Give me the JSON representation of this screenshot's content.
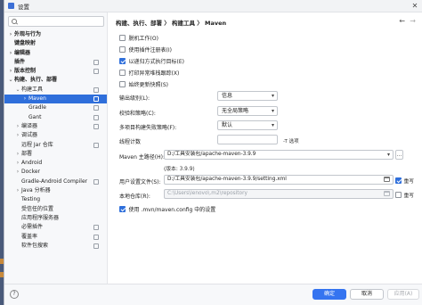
{
  "window": {
    "title": "设置"
  },
  "sidebar": {
    "search_placeholder": "",
    "items": [
      {
        "label": "外观与行为",
        "chevron": "›",
        "bold": true
      },
      {
        "label": "键盘映射",
        "chevron": "",
        "bold": true
      },
      {
        "label": "编辑器",
        "chevron": "›",
        "bold": true
      },
      {
        "label": "插件",
        "chevron": "",
        "bold": true
      },
      {
        "label": "版本控制",
        "chevron": "›",
        "bold": true
      },
      {
        "label": "构建、执行、部署",
        "chevron": "⌄",
        "bold": true
      },
      {
        "label": "构建工具",
        "chevron": "⌄",
        "bold": false
      },
      {
        "label": "Maven",
        "chevron": "›",
        "bold": false
      },
      {
        "label": "Gradle",
        "chevron": "",
        "bold": false
      },
      {
        "label": "Gant",
        "chevron": "",
        "bold": false
      },
      {
        "label": "编译器",
        "chevron": "›",
        "bold": false
      },
      {
        "label": "调试器",
        "chevron": "›",
        "bold": false
      },
      {
        "label": "远程 Jar 仓库",
        "chevron": "",
        "bold": false
      },
      {
        "label": "部署",
        "chevron": "›",
        "bold": false
      },
      {
        "label": "Android",
        "chevron": "›",
        "bold": false
      },
      {
        "label": "Docker",
        "chevron": "›",
        "bold": false
      },
      {
        "label": "Gradle-Android Compiler",
        "chevron": "",
        "bold": false
      },
      {
        "label": "Java 分析器",
        "chevron": "›",
        "bold": false
      },
      {
        "label": "Testing",
        "chevron": "",
        "bold": false
      },
      {
        "label": "受信任的位置",
        "chevron": "",
        "bold": false
      },
      {
        "label": "应用程序服务器",
        "chevron": "",
        "bold": false
      },
      {
        "label": "必需插件",
        "chevron": "",
        "bold": false
      },
      {
        "label": "覆盖率",
        "chevron": "",
        "bold": false
      },
      {
        "label": "软件包搜索",
        "chevron": "",
        "bold": false
      }
    ]
  },
  "main": {
    "breadcrumb": "构建、执行、部署 〉 构建工具 〉 Maven",
    "checkboxes": [
      {
        "label": "脱机工作(O)",
        "checked": false
      },
      {
        "label": "使用插件注册表(I)",
        "checked": false
      },
      {
        "label": "以递归方式执行目标(E)",
        "checked": true
      },
      {
        "label": "打印异常堆栈跟踪(X)",
        "checked": false
      },
      {
        "label": "始终更新快照(S)",
        "checked": false
      }
    ],
    "output_level": {
      "label": "输出级别(L):",
      "value": "信息"
    },
    "checksum_policy": {
      "label": "校验和策略(C):",
      "value": "无全局策略"
    },
    "multiproject_fail": {
      "label": "多项目构建失败策略(F):",
      "value": "默认"
    },
    "thread_count": {
      "label": "线程计数",
      "value": "",
      "hint": "-T 选项"
    },
    "maven_home": {
      "label": "Maven 主路径(H):",
      "value": "D:/工具安装包/apache-maven-3.9.9",
      "version": "(版本: 3.9.9)"
    },
    "user_settings": {
      "label": "用户设置文件(S):",
      "value": "D:/工具安装包/apache-maven-3.9.9/setting.xml",
      "override_label": "重写",
      "override_checked": true
    },
    "local_repo": {
      "label": "本地仓库(R):",
      "value": "C:\\Users\\lenovo\\.m2\\repository",
      "override_label": "重写",
      "override_checked": false
    },
    "use_config": {
      "label": "使用 .mvn/maven.config 中的设置",
      "checked": true
    }
  },
  "footer": {
    "ok": "确定",
    "cancel": "取消",
    "apply": "应用(A)"
  }
}
